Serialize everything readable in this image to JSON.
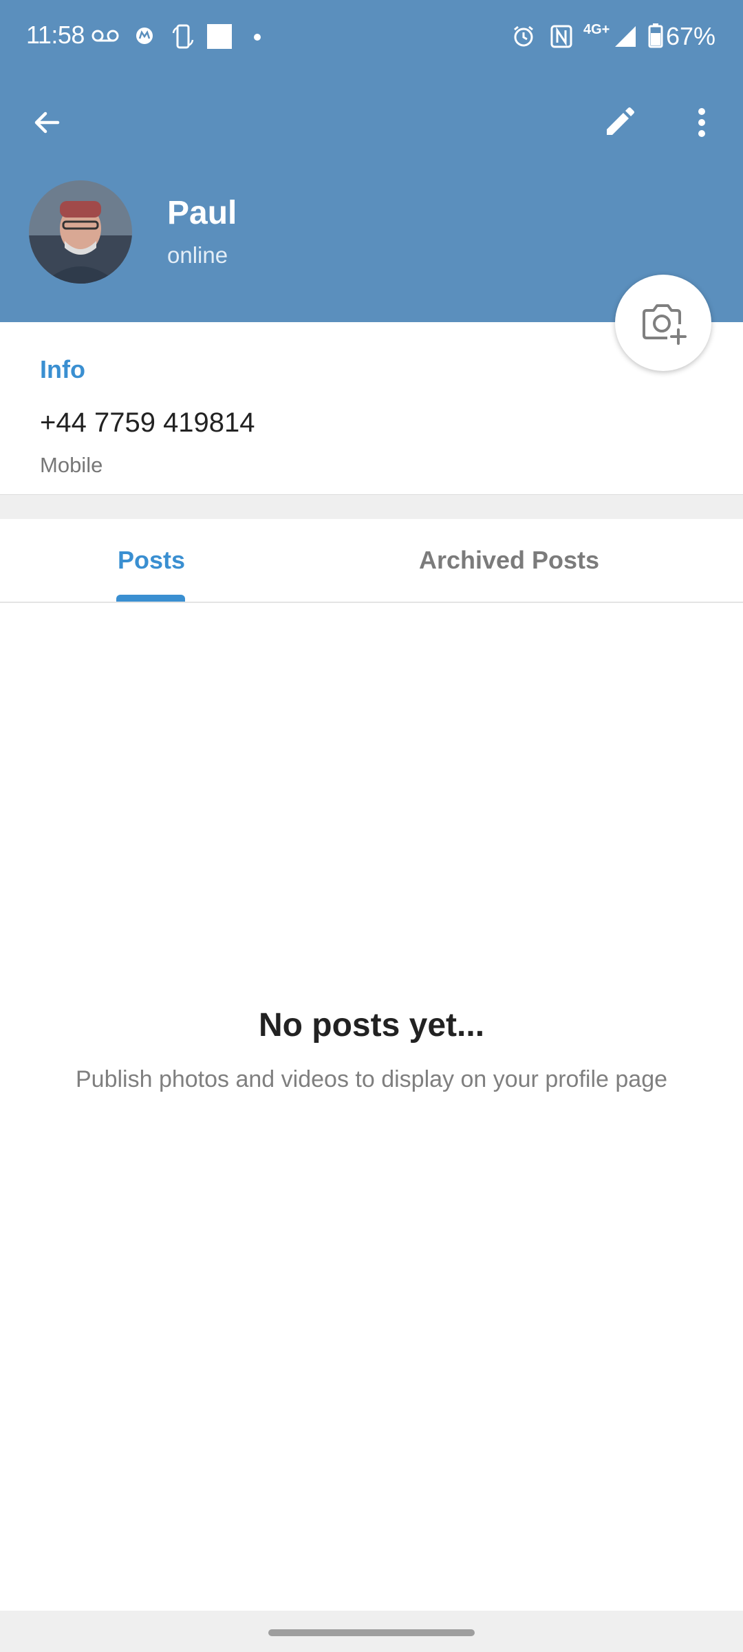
{
  "status_bar": {
    "time": "11:58",
    "network": "4G+",
    "battery": "67%"
  },
  "toolbar": {
    "back_icon": "arrow-left-icon",
    "edit_icon": "pencil-icon",
    "more_icon": "more-vert-icon"
  },
  "profile": {
    "name": "Paul",
    "status": "online"
  },
  "info": {
    "title": "Info",
    "phone": "+44 7759 419814",
    "phone_type": "Mobile"
  },
  "tabs": [
    {
      "label": "Posts",
      "active": true
    },
    {
      "label": "Archived Posts",
      "active": false
    }
  ],
  "empty_state": {
    "title": "No posts yet...",
    "description": "Publish photos and videos to display on your profile page"
  },
  "colors": {
    "header": "#5b8fbd",
    "accent": "#3a8fd1"
  }
}
